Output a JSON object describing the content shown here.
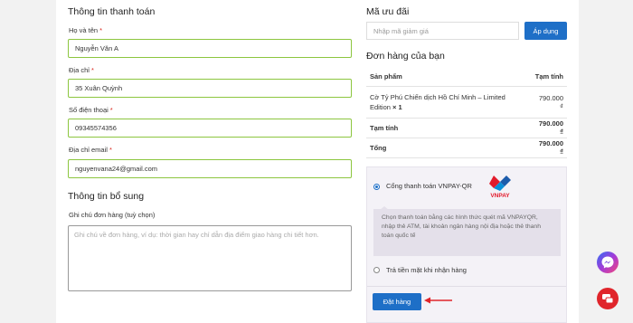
{
  "billing": {
    "title": "Thông tin thanh toán",
    "name_label": "Họ và tên",
    "name_value": "Nguyễn Văn A",
    "address_label": "Địa chỉ",
    "address_value": "35 Xuân Quỳnh",
    "phone_label": "Số điện thoại",
    "phone_value": "09345574356",
    "email_label": "Địa chỉ email",
    "email_value": "nguyenvana24@gmail.com",
    "required_mark": "*"
  },
  "additional": {
    "title": "Thông tin bổ sung",
    "notes_label": "Ghi chú đơn hàng (tuỳ chọn)",
    "notes_placeholder": "Ghi chú về đơn hàng, ví dụ: thời gian hay chỉ dẫn địa điểm giao hàng chi tiết hơn."
  },
  "coupon": {
    "title": "Mã ưu đãi",
    "placeholder": "Nhập mã giảm giá",
    "apply_label": "Áp dụng"
  },
  "order": {
    "title": "Đơn hàng của bạn",
    "col_product": "Sản phẩm",
    "col_subtotal": "Tạm tính",
    "item_name": "Cờ Tỷ Phú Chiến dịch Hồ Chí Minh – Limited Edition",
    "item_qty": "× 1",
    "item_price": "790.000 ₫",
    "subtotal_label": "Tạm tính",
    "subtotal_value": "790.000 ₫",
    "total_label": "Tổng",
    "total_value": "790.000 ₫"
  },
  "payment": {
    "vnpay_label": "Cổng thanh toán VNPAY-QR",
    "vnpay_logo_text": "VNPAY",
    "vnpay_desc": "Chọn thanh toán bằng các hình thức quét mã VNPAYQR, nhập thẻ ATM, tài khoản ngân hàng nội địa hoặc thẻ thanh toán quốc tế",
    "cod_label": "Trả tiền mặt khi nhận hàng",
    "place_order_label": "Đặt hàng"
  },
  "colors": {
    "accent": "#1e6fc7",
    "field_border": "#8cc63f",
    "required": "#d9261c",
    "arrow": "#e0252b"
  }
}
